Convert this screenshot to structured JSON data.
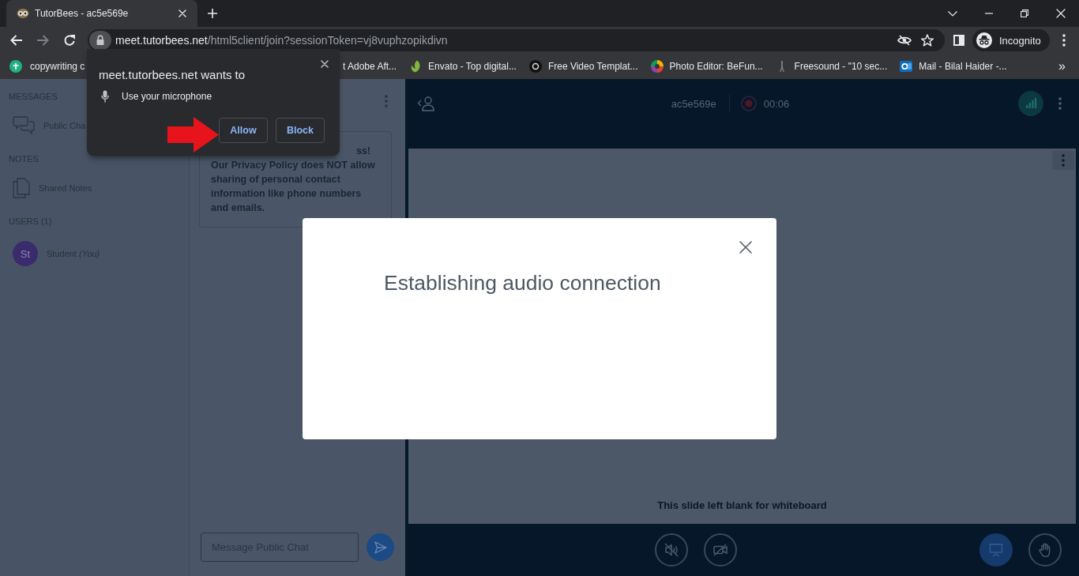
{
  "browser": {
    "tabs": [
      {
        "title": "TutorBees - ac5e569e",
        "selected": true
      }
    ],
    "toolbar": {
      "forward_disabled": true,
      "url_host": "meet.tutorbees.net",
      "url_path": "/html5client/join?sessionToken=vj8vuphzopikdivn",
      "profile_label": "Incognito"
    },
    "bookmarks": [
      {
        "label": "copywriting c"
      },
      {
        "label": "t Adobe Aft..."
      },
      {
        "label": "Envato - Top digital..."
      },
      {
        "label": "Free Video Templat..."
      },
      {
        "label": "Photo Editor: BeFun..."
      },
      {
        "label": "Freesound - \"10 sec..."
      },
      {
        "label": "Mail - Bilal Haider -..."
      }
    ],
    "bookmarks_overflow": "»"
  },
  "permission_prompt": {
    "title": "meet.tutorbees.net wants to",
    "permission": "Use your microphone",
    "buttons": [
      "Allow",
      "Block"
    ]
  },
  "sidebar": {
    "sections": [
      {
        "title": "MESSAGES",
        "items": [
          {
            "label": "Public Cha"
          }
        ]
      },
      {
        "title": "NOTES",
        "items": [
          {
            "label": "Shared Notes"
          }
        ]
      },
      {
        "title": "USERS (1)",
        "users": [
          {
            "initials": "St",
            "name": "Student *(You)*"
          }
        ]
      }
    ]
  },
  "chat": {
    "welcome_fragment": "ss!",
    "welcome_text": "Our Privacy Policy does NOT allow sharing of personal contact information like phone numbers and emails.",
    "input": {
      "placeholder": "Message Public Chat"
    }
  },
  "meeting": {
    "name": "ac5e569e",
    "timer": "00:06",
    "slide_caption": "This slide left blank for whiteboard",
    "controls": [
      {
        "kind": "audio",
        "on": false
      },
      {
        "kind": "video",
        "on": false
      },
      {
        "kind": "presentation",
        "on": true
      },
      {
        "kind": "hand",
        "on": false
      }
    ]
  },
  "modal": {
    "message": "Establishing audio connection"
  }
}
